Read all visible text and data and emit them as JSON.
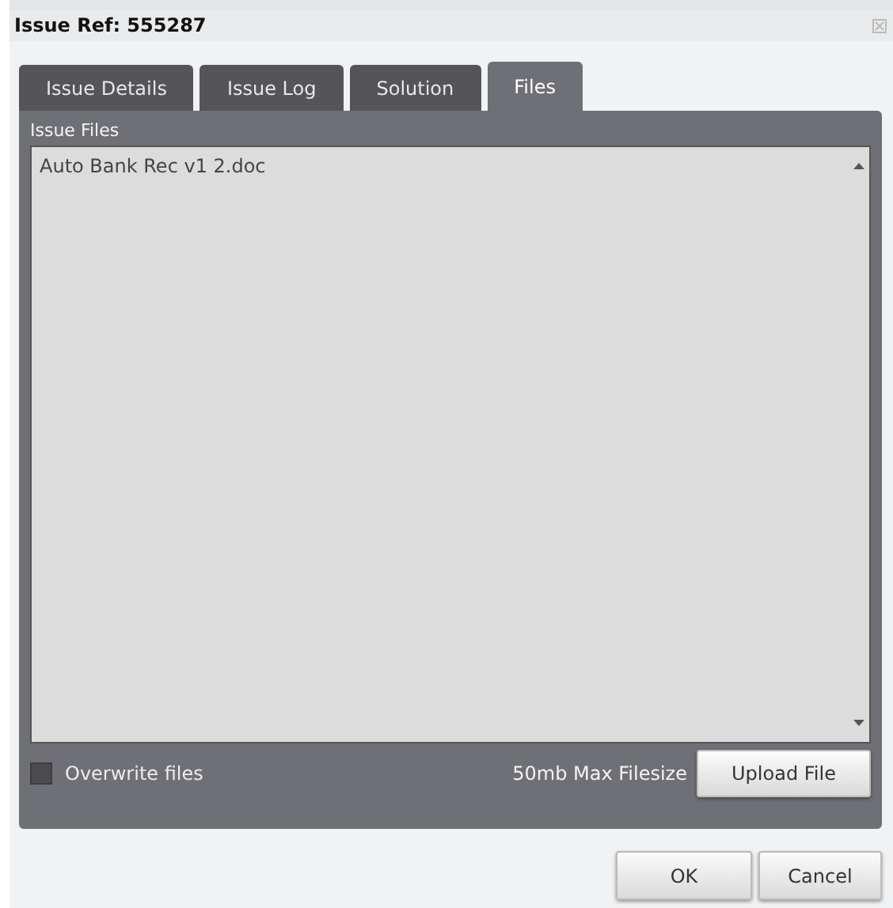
{
  "window": {
    "title": "Issue Ref: 555287"
  },
  "tabs": [
    {
      "label": "Issue Details",
      "selected": false
    },
    {
      "label": "Issue Log",
      "selected": false
    },
    {
      "label": "Solution",
      "selected": false
    },
    {
      "label": "Files",
      "selected": true
    }
  ],
  "panel": {
    "title": "Issue Files",
    "files": [
      "Auto Bank Rec v1 2.doc"
    ],
    "overwrite": {
      "label": "Overwrite files",
      "checked": false
    },
    "max_size": "50mb Max Filesize",
    "upload_button": "Upload File"
  },
  "buttons": [
    "OK",
    "Cancel"
  ]
}
